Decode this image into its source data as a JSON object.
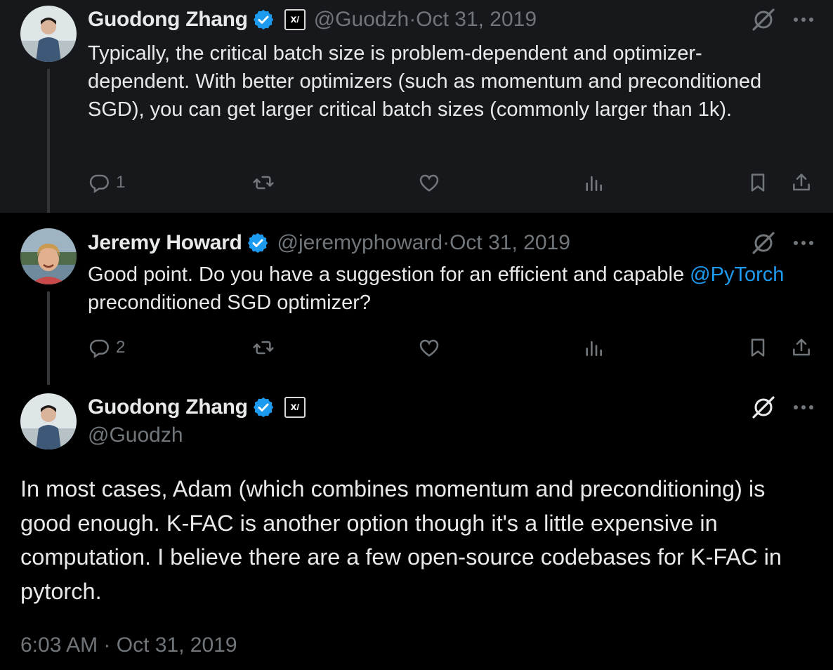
{
  "tweets": [
    {
      "author": {
        "name": "Guodong Zhang",
        "handle": "@Guodzh",
        "verified": true,
        "affiliate_badge": "xAI"
      },
      "date": "Oct 31, 2019",
      "text": "Typically, the critical batch size is problem-dependent and optimizer-dependent. With better optimizers (such as momentum and preconditioned SGD), you can get larger critical batch sizes (commonly larger than 1k).",
      "reply_count": "1"
    },
    {
      "author": {
        "name": "Jeremy Howard",
        "handle": "@jeremyphoward",
        "verified": true
      },
      "date": "Oct 31, 2019",
      "text_before_mention": "Good point. Do you have a suggestion for an efficient and capable ",
      "mention": "@PyTorch",
      "text_after_mention": " preconditioned SGD optimizer?",
      "reply_count": "2"
    },
    {
      "author": {
        "name": "Guodong Zhang",
        "handle": "@Guodzh",
        "verified": true,
        "affiliate_badge": "xAI"
      },
      "text": "In most cases, Adam (which combines momentum and preconditioning) is good enough. K-FAC is another option though it's a little expensive in computation. I believe there are a few open-source codebases for K-FAC in pytorch.",
      "time": "6:03 AM",
      "date": "Oct 31, 2019"
    }
  ],
  "separator": " · ",
  "colors": {
    "background": "#000000",
    "highlight_background": "#16181c",
    "text": "#e7e9ea",
    "secondary_text": "#71767b",
    "link": "#1d9bf0",
    "verified": "#1d9bf0",
    "thread_line": "#333639"
  },
  "icons": [
    "verified-badge-icon",
    "affiliate-badge-icon",
    "grok-icon",
    "more-icon",
    "reply-icon",
    "retweet-icon",
    "like-icon",
    "views-icon",
    "bookmark-icon",
    "share-icon"
  ]
}
